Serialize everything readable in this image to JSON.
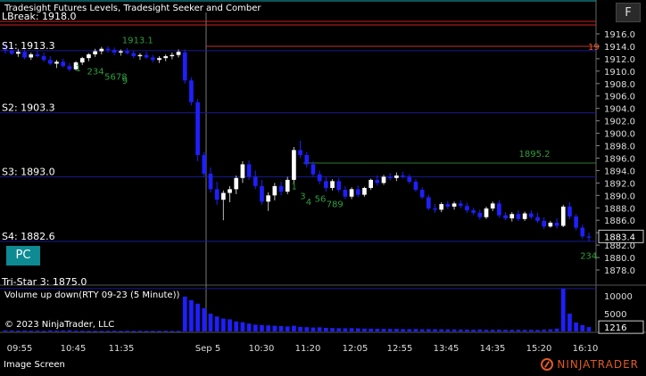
{
  "chart_title": "Tradesight Futures Levels, Tradesight Seeker and Comber",
  "volume_label": "Volume up down(RTY 09-23 (5 Minute))",
  "copyright": "© 2023 NinjaTrader, LLC",
  "footer_label": "Image Screen",
  "logo_text": "NINJATRADER",
  "pc_button": "PC",
  "f_button": "F",
  "colors": {
    "up_candle": "#ffffff",
    "down_candle": "#1f1fff",
    "level_line": "#1a1a90",
    "lbreak_line": "#d02020",
    "seeker": "#2e9e3e",
    "pc_button": "#0d8a92",
    "price_tag": "#e05a24"
  },
  "levels": [
    {
      "label": "LBreak: 1918.0",
      "price": 1918.0
    },
    {
      "label": "S1: 1913.3",
      "price": 1913.3
    },
    {
      "label": "S2: 1903.3",
      "price": 1903.3
    },
    {
      "label": "S3: 1893.0",
      "price": 1893.0
    },
    {
      "label": "S4: 1882.6",
      "price": 1882.6
    },
    {
      "label": "Tri-Star 3: 1875.0",
      "price": 1875.0
    }
  ],
  "current_price": "1883.4",
  "right_edge_tag": "19",
  "vol_current": "1216",
  "green_labels": [
    {
      "text": "1913.1",
      "price": 1914.5,
      "at": 0.2
    },
    {
      "text": "1895.2",
      "price": 1896.2,
      "at": 0.88
    }
  ],
  "chart_data": {
    "type": "candlestick",
    "price_axis": {
      "ylim": [
        1876,
        1917
      ],
      "ticks": [
        1916,
        1914,
        1912,
        1910,
        1908,
        1906,
        1904,
        1902,
        1900,
        1898,
        1896,
        1894,
        1892,
        1890,
        1888,
        1886,
        1884,
        1882,
        1880,
        1878
      ]
    },
    "volume_axis": {
      "ylim": [
        0,
        12000
      ],
      "ticks": [
        10000,
        5000
      ]
    },
    "time_labels": [
      "09:55",
      "10:45",
      "11:35",
      "Sep 5",
      "10:30",
      "11:20",
      "12:05",
      "12:55",
      "13:45",
      "14:35",
      "15:20",
      "16:10"
    ],
    "seeker_counts": [
      {
        "text": "1",
        "price": 1910.0,
        "at": 0.12
      },
      {
        "text": "234",
        "price": 1909.5,
        "at": 0.14
      },
      {
        "text": "5678",
        "price": 1908.6,
        "at": 0.17
      },
      {
        "text": "9",
        "price": 1908.0,
        "at": 0.2
      },
      {
        "text": "1",
        "price": 1891.0,
        "at": 0.49
      },
      {
        "text": "3",
        "price": 1889.4,
        "at": 0.505
      },
      {
        "text": "4",
        "price": 1888.5,
        "at": 0.515
      },
      {
        "text": "56",
        "price": 1889.0,
        "at": 0.53
      },
      {
        "text": "789",
        "price": 1888.1,
        "at": 0.55
      },
      {
        "text": "234",
        "price": 1879.8,
        "at": 0.985
      }
    ],
    "candles": [
      [
        1913.5,
        1914.5,
        1912.8,
        1913.3
      ],
      [
        1913.3,
        1914.0,
        1912.6,
        1912.8
      ],
      [
        1912.8,
        1913.6,
        1912.3,
        1913.1
      ],
      [
        1913.1,
        1913.5,
        1911.9,
        1912.2
      ],
      [
        1912.2,
        1913.0,
        1911.8,
        1912.7
      ],
      [
        1912.7,
        1913.3,
        1912.2,
        1912.4
      ],
      [
        1912.4,
        1913.0,
        1911.5,
        1911.8
      ],
      [
        1911.8,
        1912.4,
        1911.0,
        1911.2
      ],
      [
        1911.2,
        1911.8,
        1910.5,
        1911.5
      ],
      [
        1911.5,
        1912.0,
        1910.6,
        1910.8
      ],
      [
        1910.8,
        1911.3,
        1910.0,
        1910.3
      ],
      [
        1910.3,
        1911.6,
        1910.1,
        1911.4
      ],
      [
        1911.4,
        1912.3,
        1911.0,
        1912.1
      ],
      [
        1912.1,
        1912.9,
        1911.6,
        1912.7
      ],
      [
        1912.7,
        1913.6,
        1912.3,
        1913.2
      ],
      [
        1913.2,
        1913.9,
        1912.7,
        1913.6
      ],
      [
        1913.6,
        1914.0,
        1913.0,
        1913.4
      ],
      [
        1913.4,
        1913.8,
        1912.6,
        1913.0
      ],
      [
        1913.0,
        1913.5,
        1912.5,
        1913.2
      ],
      [
        1913.2,
        1913.7,
        1912.7,
        1912.9
      ],
      [
        1912.9,
        1913.3,
        1912.1,
        1912.4
      ],
      [
        1912.4,
        1912.9,
        1911.8,
        1912.6
      ],
      [
        1912.6,
        1913.1,
        1912.0,
        1912.2
      ],
      [
        1912.2,
        1912.6,
        1911.4,
        1911.8
      ],
      [
        1911.8,
        1912.4,
        1911.3,
        1912.1
      ],
      [
        1912.1,
        1912.7,
        1911.6,
        1912.4
      ],
      [
        1912.4,
        1913.0,
        1911.9,
        1912.6
      ],
      [
        1912.6,
        1913.5,
        1912.2,
        1913.1
      ],
      [
        1913.0,
        1913.5,
        1908.0,
        1908.5
      ],
      [
        1908.5,
        1909.0,
        1904.5,
        1905.0
      ],
      [
        1905.0,
        1905.5,
        1895.5,
        1896.5
      ],
      [
        1896.5,
        1897.0,
        1893.0,
        1893.5
      ],
      [
        1893.5,
        1894.5,
        1890.5,
        1891.0
      ],
      [
        1891.0,
        1892.2,
        1888.5,
        1889.3
      ],
      [
        1889.3,
        1890.8,
        1886.0,
        1890.4
      ],
      [
        1890.4,
        1891.5,
        1888.9,
        1891.0
      ],
      [
        1891.0,
        1893.2,
        1890.2,
        1892.8
      ],
      [
        1892.8,
        1895.5,
        1892.0,
        1895.0
      ],
      [
        1895.0,
        1895.6,
        1892.5,
        1893.0
      ],
      [
        1893.0,
        1894.0,
        1891.0,
        1891.5
      ],
      [
        1891.5,
        1892.5,
        1888.5,
        1889.0
      ],
      [
        1889.0,
        1890.5,
        1887.5,
        1890.0
      ],
      [
        1890.0,
        1892.0,
        1889.2,
        1891.5
      ],
      [
        1891.5,
        1892.2,
        1890.0,
        1890.6
      ],
      [
        1890.6,
        1893.0,
        1890.2,
        1892.5
      ],
      [
        1892.5,
        1897.8,
        1892.0,
        1897.3
      ],
      [
        1897.3,
        1898.8,
        1896.0,
        1896.5
      ],
      [
        1896.5,
        1897.0,
        1894.5,
        1895.0
      ],
      [
        1895.0,
        1895.5,
        1893.0,
        1893.4
      ],
      [
        1893.4,
        1894.0,
        1891.8,
        1892.3
      ],
      [
        1892.3,
        1893.0,
        1890.6,
        1891.2
      ],
      [
        1891.2,
        1892.6,
        1890.8,
        1892.3
      ],
      [
        1892.3,
        1892.8,
        1890.5,
        1890.9
      ],
      [
        1890.9,
        1891.5,
        1889.4,
        1889.8
      ],
      [
        1889.8,
        1891.3,
        1889.4,
        1891.0
      ],
      [
        1891.0,
        1891.6,
        1889.7,
        1890.1
      ],
      [
        1890.1,
        1891.4,
        1889.8,
        1891.2
      ],
      [
        1891.2,
        1892.7,
        1890.9,
        1892.5
      ],
      [
        1892.5,
        1893.2,
        1891.6,
        1892.0
      ],
      [
        1892.0,
        1893.3,
        1891.7,
        1893.0
      ],
      [
        1893.0,
        1893.6,
        1892.4,
        1892.8
      ],
      [
        1892.8,
        1893.7,
        1892.3,
        1893.2
      ],
      [
        1893.2,
        1893.8,
        1892.7,
        1893.0
      ],
      [
        1893.0,
        1893.4,
        1891.9,
        1892.2
      ],
      [
        1892.2,
        1892.6,
        1890.6,
        1890.9
      ],
      [
        1890.9,
        1891.3,
        1889.4,
        1889.7
      ],
      [
        1889.7,
        1890.1,
        1887.6,
        1887.9
      ],
      [
        1887.9,
        1888.6,
        1887.2,
        1887.7
      ],
      [
        1887.7,
        1888.9,
        1887.3,
        1888.6
      ],
      [
        1888.6,
        1889.1,
        1887.8,
        1888.2
      ],
      [
        1888.2,
        1889.0,
        1887.7,
        1888.7
      ],
      [
        1888.7,
        1889.2,
        1887.9,
        1888.3
      ],
      [
        1888.3,
        1888.8,
        1887.2,
        1887.6
      ],
      [
        1887.6,
        1888.0,
        1886.8,
        1887.2
      ],
      [
        1887.2,
        1887.7,
        1886.1,
        1886.5
      ],
      [
        1886.5,
        1888.2,
        1886.2,
        1887.9
      ],
      [
        1887.9,
        1889.0,
        1887.5,
        1888.7
      ],
      [
        1888.7,
        1889.2,
        1886.4,
        1886.8
      ],
      [
        1886.8,
        1887.3,
        1886.0,
        1886.3
      ],
      [
        1886.3,
        1887.3,
        1885.8,
        1887.0
      ],
      [
        1887.0,
        1887.6,
        1885.9,
        1886.2
      ],
      [
        1886.2,
        1887.4,
        1885.9,
        1887.1
      ],
      [
        1887.1,
        1887.6,
        1886.2,
        1886.5
      ],
      [
        1886.5,
        1887.2,
        1885.6,
        1885.9
      ],
      [
        1885.9,
        1886.5,
        1884.6,
        1885.0
      ],
      [
        1885.0,
        1885.9,
        1884.8,
        1885.6
      ],
      [
        1885.6,
        1886.3,
        1884.7,
        1885.1
      ],
      [
        1885.1,
        1888.5,
        1884.9,
        1888.2
      ],
      [
        1888.2,
        1888.9,
        1886.2,
        1886.6
      ],
      [
        1886.6,
        1887.0,
        1884.4,
        1884.8
      ],
      [
        1884.8,
        1885.3,
        1883.0,
        1883.4
      ],
      [
        1883.4,
        1884.0,
        1882.6,
        1883.2
      ]
    ],
    "volume": [
      300,
      250,
      200,
      260,
      180,
      220,
      150,
      300,
      240,
      270,
      350,
      200,
      180,
      150,
      160,
      140,
      170,
      220,
      130,
      210,
      150,
      180,
      140,
      160,
      170,
      190,
      120,
      150,
      9800,
      8800,
      7800,
      6500,
      5000,
      4200,
      3600,
      3400,
      2800,
      2600,
      2200,
      1900,
      1800,
      1700,
      1600,
      1500,
      1400,
      1600,
      1300,
      1200,
      1100,
      1150,
      1000,
      950,
      900,
      880,
      920,
      860,
      800,
      780,
      760,
      740,
      700,
      720,
      680,
      650,
      700,
      600,
      640,
      620,
      600,
      580,
      560,
      540,
      520,
      500,
      560,
      480,
      500,
      520,
      480,
      460,
      500,
      440,
      460,
      420,
      520,
      600,
      800,
      12000,
      5000,
      2500,
      1800,
      1216
    ]
  }
}
